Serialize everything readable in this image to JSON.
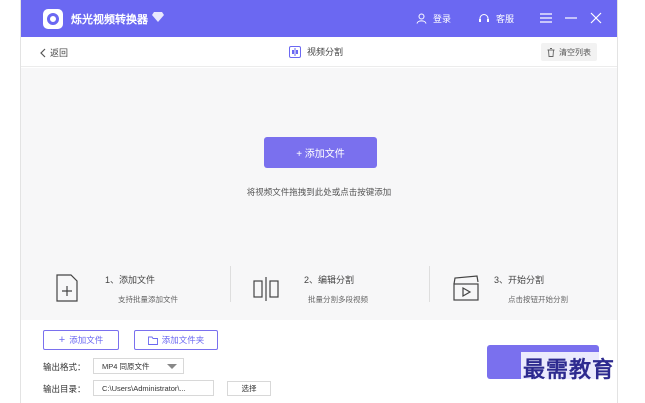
{
  "titlebar": {
    "app_title": "烁光视频转换器",
    "login_label": "登录",
    "service_label": "客服",
    "accent": "#6b68f2"
  },
  "subbar": {
    "back_label": "返回",
    "mode_label": "视频分割",
    "clear_label": "清空列表"
  },
  "dropzone": {
    "add_button_label": "+ 添加文件",
    "hint": "将视频文件拖拽到此处或点击按键添加"
  },
  "steps": [
    {
      "title": "1、添加文件",
      "desc": "支持批量添加文件",
      "icon": "add-file-icon"
    },
    {
      "title": "2、编辑分割",
      "desc": "批量分割多段视频",
      "icon": "split-icon"
    },
    {
      "title": "3、开始分割",
      "desc": "点击按钮开始分割",
      "icon": "clapper-icon"
    }
  ],
  "bottom": {
    "add_file_label": "添加文件",
    "add_folder_label": "添加文件夹",
    "format_label": "输出格式：",
    "format_value": "MP4 同原文件",
    "dir_label": "输出目录：",
    "dir_value": "C:\\Users\\Administrator\\...",
    "choose_label": "选择"
  },
  "watermark": "最需教育"
}
